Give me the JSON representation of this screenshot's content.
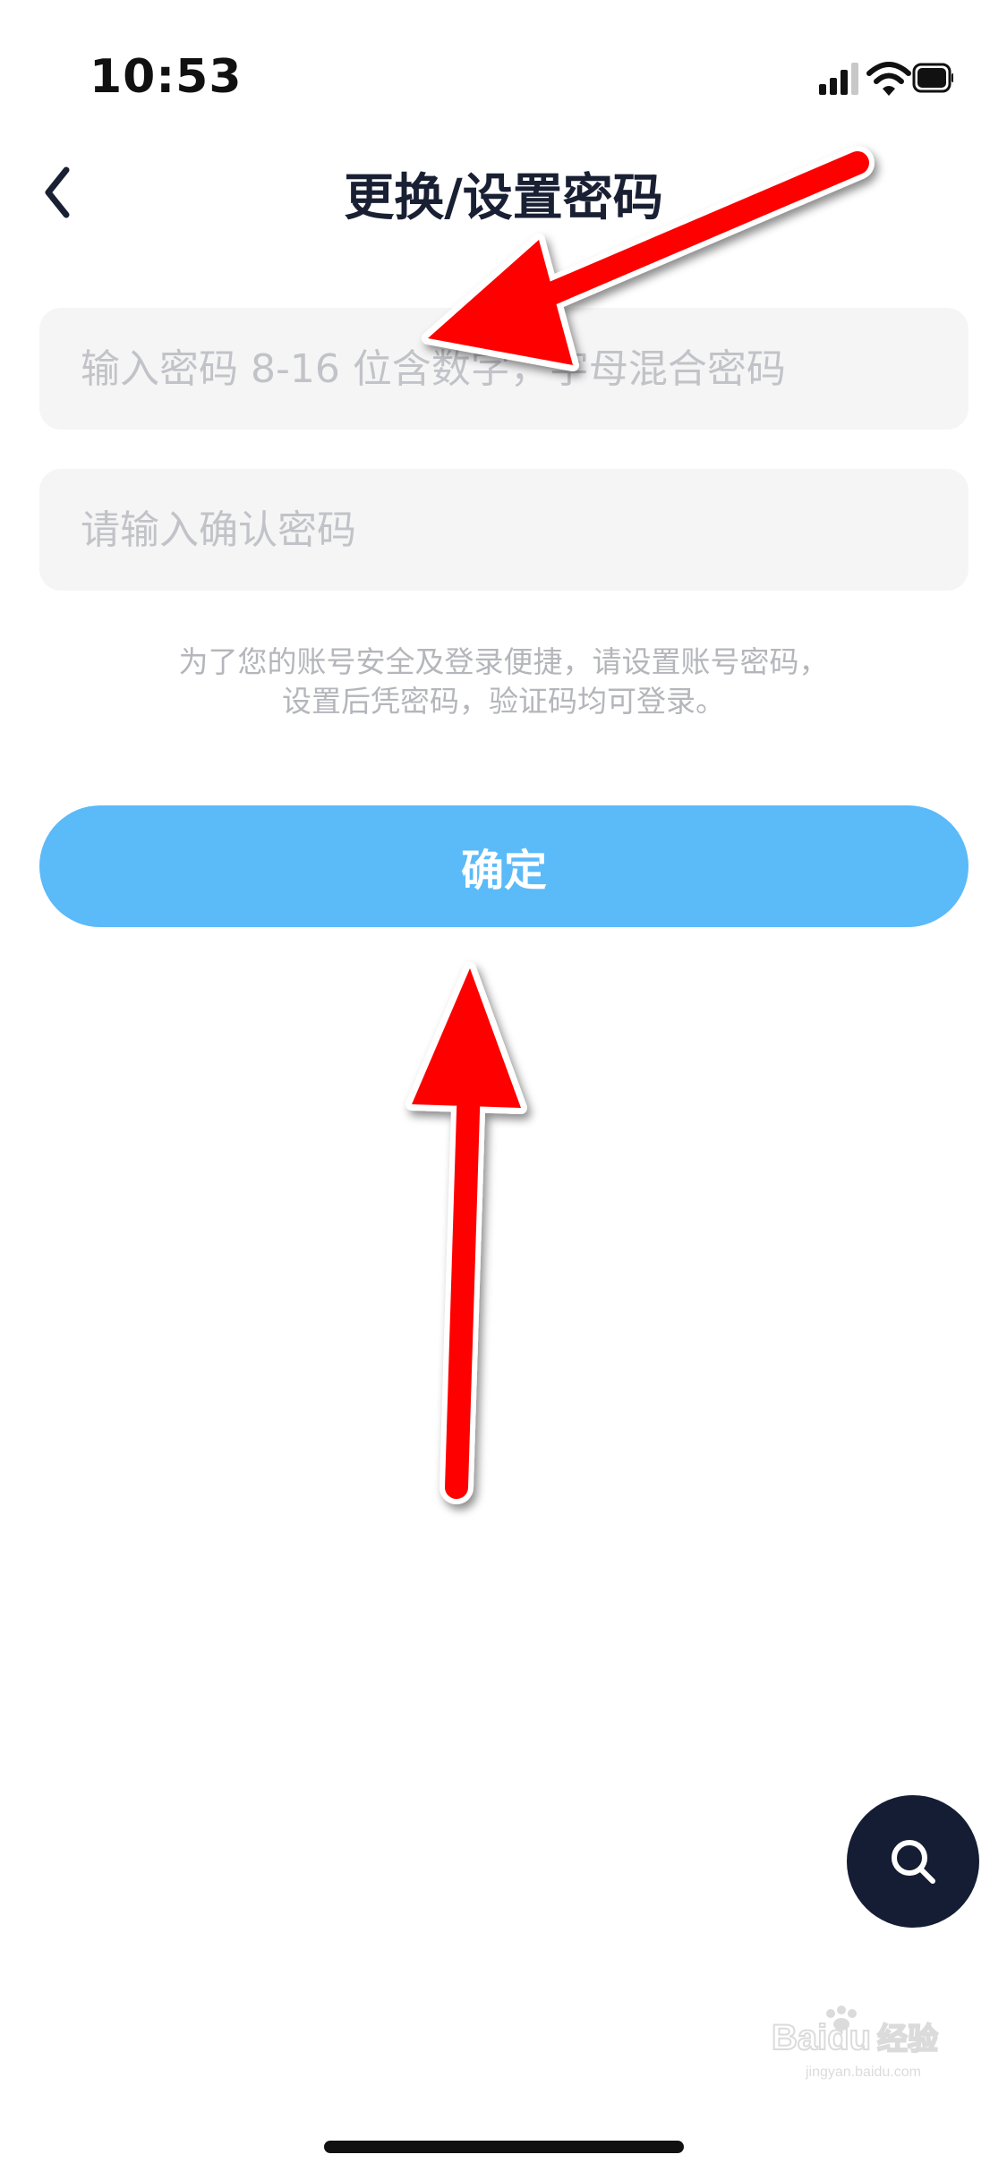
{
  "status_bar": {
    "time": "10:53",
    "icons": [
      "signal-icon",
      "wifi-icon",
      "battery-icon"
    ]
  },
  "header": {
    "back_icon": "chevron-left-icon",
    "title": "更换/设置密码"
  },
  "form": {
    "password_placeholder": "输入密码 8-16 位含数字，字母混合密码",
    "password_value": "",
    "confirm_placeholder": "请输入确认密码",
    "confirm_value": "",
    "hint_line1": "为了您的账号安全及登录便捷，请设置账号密码，",
    "hint_line2": "设置后凭密码，验证码均可登录。",
    "submit_label": "确定"
  },
  "floating_button": {
    "icon": "search-icon"
  },
  "watermark": {
    "text": "Baidu经验",
    "subtext": "jingyan.baidu.com"
  },
  "colors": {
    "primary_button": "#5bbaf8",
    "title_text": "#1a2033",
    "input_background": "#f5f5f6",
    "placeholder_text": "#c2c3c8",
    "hint_text": "#b4b6bb",
    "fab_background": "#141d33",
    "annotation_arrow": "#ff0000"
  }
}
